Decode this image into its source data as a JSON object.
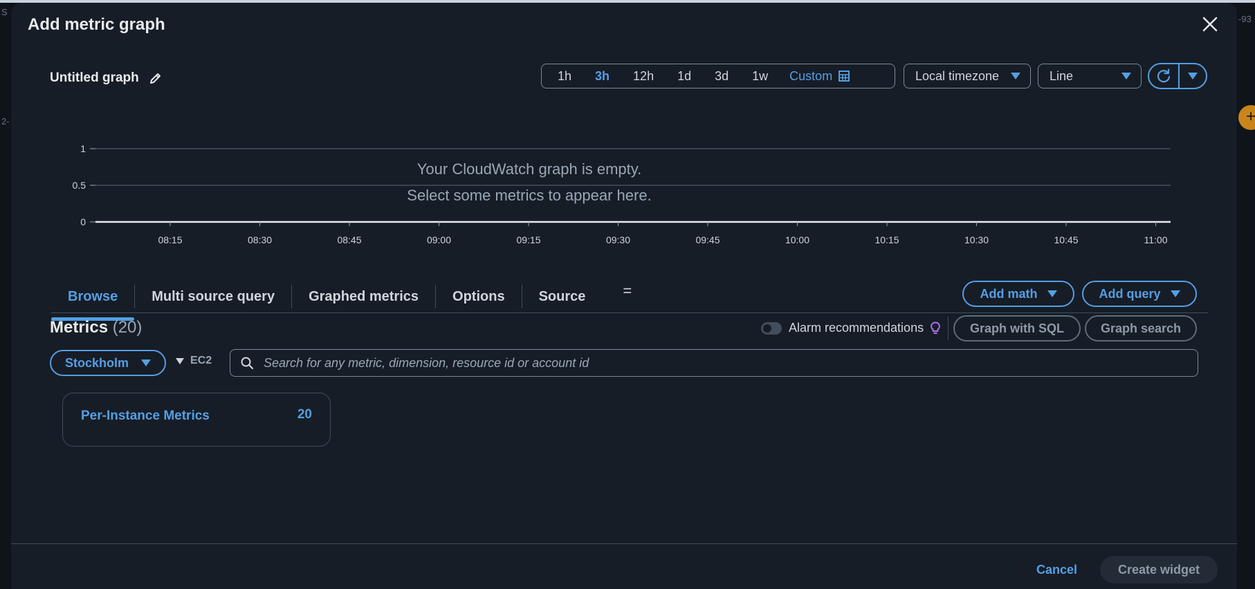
{
  "background": {
    "left_fragment_1": "S",
    "left_fragment_2": "2-",
    "right_fragment_1": "-93"
  },
  "modal": {
    "title": "Add metric graph",
    "close_icon": "close-icon"
  },
  "graph": {
    "title": "Untitled graph",
    "edit_icon": "pencil-icon",
    "time_ranges": [
      "1h",
      "3h",
      "12h",
      "1d",
      "3d",
      "1w"
    ],
    "selected_range": "3h",
    "custom_label": "Custom",
    "timezone": "Local timezone",
    "chart_type": "Line",
    "refresh_icon": "refresh-icon"
  },
  "chart_data": {
    "type": "line",
    "series": [],
    "x": [
      "08:15",
      "08:30",
      "08:45",
      "09:00",
      "09:15",
      "09:30",
      "09:45",
      "10:00",
      "10:15",
      "10:30",
      "10:45",
      "11:00"
    ],
    "y_ticks": [
      "1",
      "0.5",
      "0"
    ],
    "ylim": [
      0,
      1
    ],
    "grid": true,
    "empty_message_line1": "Your CloudWatch graph is empty.",
    "empty_message_line2": "Select some metrics to appear here."
  },
  "tabs": [
    {
      "label": "Browse",
      "active": true
    },
    {
      "label": "Multi source query",
      "active": false
    },
    {
      "label": "Graphed metrics",
      "active": false
    },
    {
      "label": "Options",
      "active": false
    },
    {
      "label": "Source",
      "active": false
    }
  ],
  "tabs_more_label": "=",
  "actions": {
    "add_math": "Add math",
    "add_query": "Add query"
  },
  "metrics": {
    "title": "Metrics",
    "count": "(20)",
    "alarm_recommendations": "Alarm recommendations",
    "alarm_toggle_on": false,
    "graph_with_sql": "Graph with SQL",
    "graph_search": "Graph search",
    "region": "Stockholm",
    "breadcrumb": "EC2",
    "search_placeholder": "Search for any metric, dimension, resource id or account id",
    "search_value": "",
    "cards": [
      {
        "title": "Per-Instance Metrics",
        "count": "20"
      }
    ]
  },
  "footer": {
    "cancel": "Cancel",
    "create_widget": "Create widget"
  },
  "colors": {
    "accent": "#539fe5",
    "modal_bg": "#161d26",
    "alarm_bulb": "#b36ff2"
  }
}
